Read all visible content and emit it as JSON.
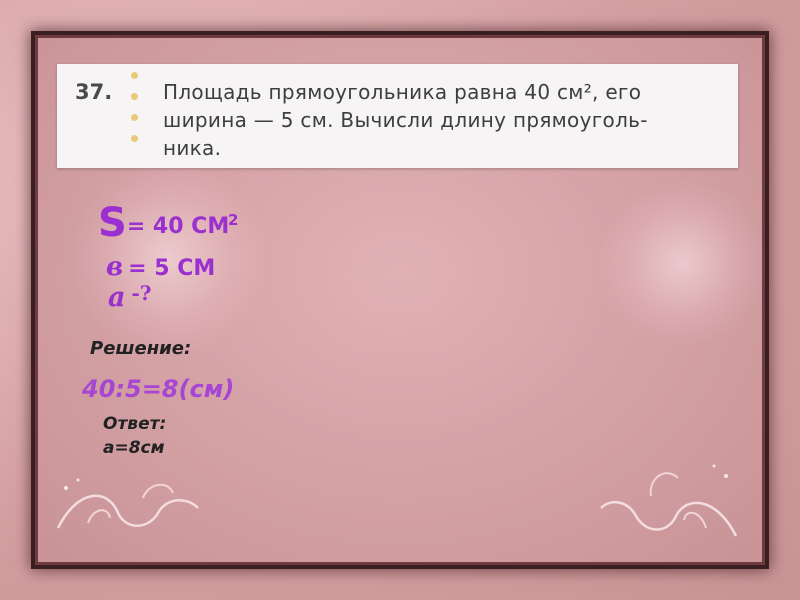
{
  "task": {
    "number": "37.",
    "line1": "Площадь прямоугольника равна 40 см², его",
    "line2": "ширина — 5 см. Вычисли длину прямоуголь-",
    "line3": "ника."
  },
  "given": {
    "area_symbol": "S",
    "area_value": "= 40 СМ",
    "area_exponent": "2",
    "width_symbol": "в",
    "width_value": "= 5 СМ",
    "length_symbol": "а",
    "length_value": "-?"
  },
  "solution": {
    "label": "Решение:",
    "calculation": "40:5=8(см)",
    "answer": "Ответ: а=8см"
  },
  "colors": {
    "accent": "#9a30cf",
    "frame_outer": "#d49ea1",
    "frame_border": "#3b1e21"
  },
  "decor": [
    "flourish-left",
    "flourish-right",
    "rose-watermark"
  ]
}
